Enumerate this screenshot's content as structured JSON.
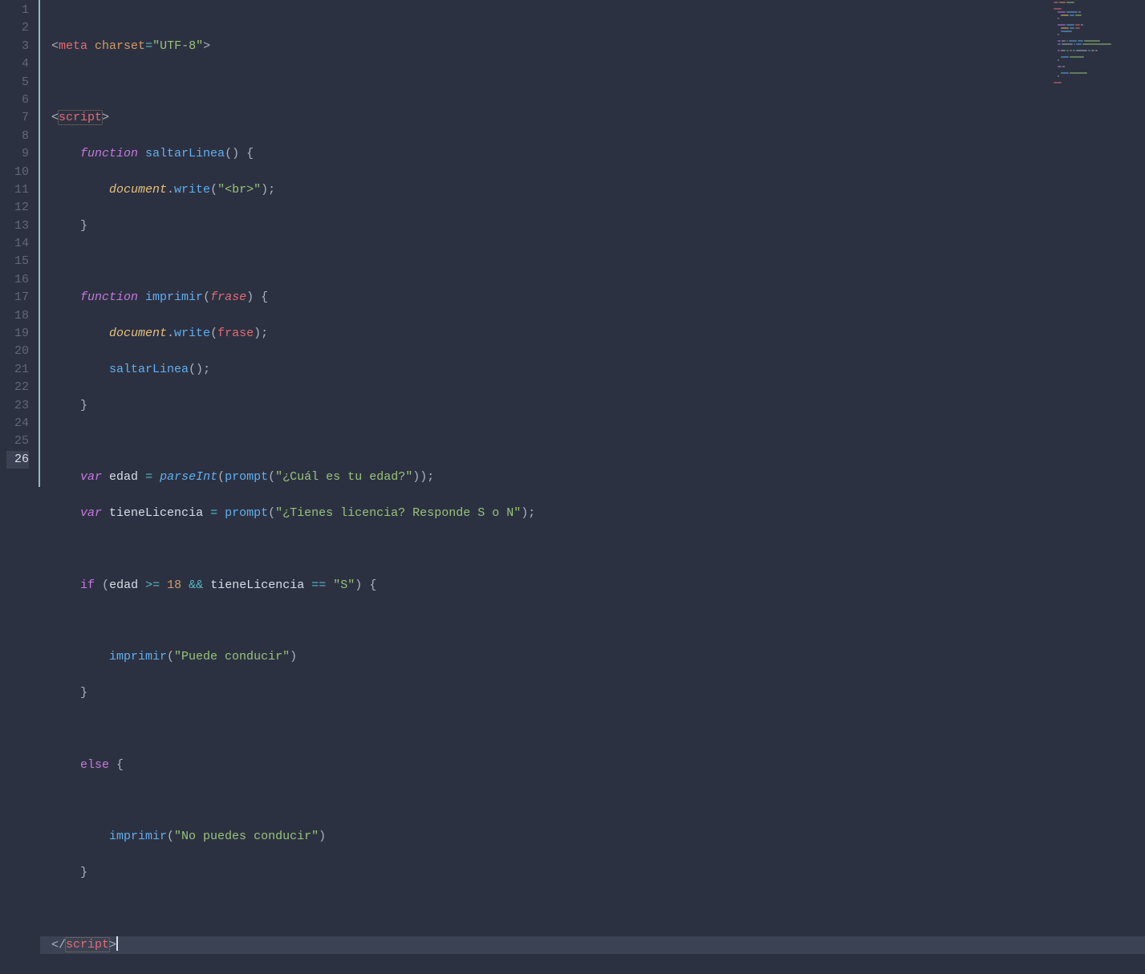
{
  "editor": {
    "total_lines": 26,
    "current_line": 26,
    "tokens": {
      "l1": {
        "ab_open": "<",
        "meta": "meta",
        "sp1": " ",
        "attr": "charset",
        "eq": "=",
        "val": "\"UTF-8\"",
        "ab_close": ">"
      },
      "l3": {
        "ab_open": "<",
        "tag": "script",
        "ab_close": ">"
      },
      "l4": {
        "indent": "    ",
        "fn_kw": "function",
        "sp": " ",
        "fn_name": "saltarLinea",
        "parens": "()",
        "sp2": " ",
        "brace": "{"
      },
      "l5": {
        "indent": "        ",
        "doc": "document",
        "dot": ".",
        "write": "write",
        "open": "(",
        "str": "\"<br>\"",
        "close": ")",
        "semi": ";"
      },
      "l6": {
        "indent": "    ",
        "brace": "}"
      },
      "l8": {
        "indent": "    ",
        "fn_kw": "function",
        "sp": " ",
        "fn_name": "imprimir",
        "open": "(",
        "param": "frase",
        "close": ")",
        "sp2": " ",
        "brace": "{"
      },
      "l9": {
        "indent": "        ",
        "doc": "document",
        "dot": ".",
        "write": "write",
        "open": "(",
        "arg": "frase",
        "close": ")",
        "semi": ";"
      },
      "l10": {
        "indent": "        ",
        "call": "saltarLinea",
        "parens": "()",
        "semi": ";"
      },
      "l11": {
        "indent": "    ",
        "brace": "}"
      },
      "l13": {
        "indent": "    ",
        "var_kw": "var",
        "sp": " ",
        "name": "edad",
        "sp2": " ",
        "eq": "=",
        "sp3": " ",
        "parse": "parseInt",
        "open": "(",
        "prompt": "prompt",
        "open2": "(",
        "str": "\"¿Cuál es tu edad?\"",
        "close2": ")",
        "close": ")",
        "semi": ";"
      },
      "l14": {
        "indent": "    ",
        "var_kw": "var",
        "sp": " ",
        "name": "tieneLicencia",
        "sp2": " ",
        "eq": "=",
        "sp3": " ",
        "prompt": "prompt",
        "open": "(",
        "str": "\"¿Tienes licencia? Responde S o N\"",
        "close": ")",
        "semi": ";"
      },
      "l16": {
        "indent": "    ",
        "if_kw": "if",
        "sp": " ",
        "open": "(",
        "edad": "edad",
        "sp2": " ",
        "gte": ">=",
        "sp3": " ",
        "num": "18",
        "sp4": " ",
        "and": "&&",
        "sp5": " ",
        "tiene": "tieneLicencia",
        "sp6": " ",
        "eqeq": "==",
        "sp7": " ",
        "str": "\"S\"",
        "close": ")",
        "sp8": " ",
        "brace": "{"
      },
      "l18": {
        "indent": "        ",
        "call": "imprimir",
        "open": "(",
        "str": "\"Puede conducir\"",
        "close": ")"
      },
      "l19": {
        "indent": "    ",
        "brace": "}"
      },
      "l21": {
        "indent": "    ",
        "else_kw": "else",
        "sp": " ",
        "brace": "{"
      },
      "l23": {
        "indent": "        ",
        "call": "imprimir",
        "open": "(",
        "str": "\"No puedes conducir\"",
        "close": ")"
      },
      "l24": {
        "indent": "    ",
        "brace": "}"
      },
      "l26": {
        "ab_open": "</",
        "tag": "script",
        "ab_close": ">"
      }
    }
  }
}
